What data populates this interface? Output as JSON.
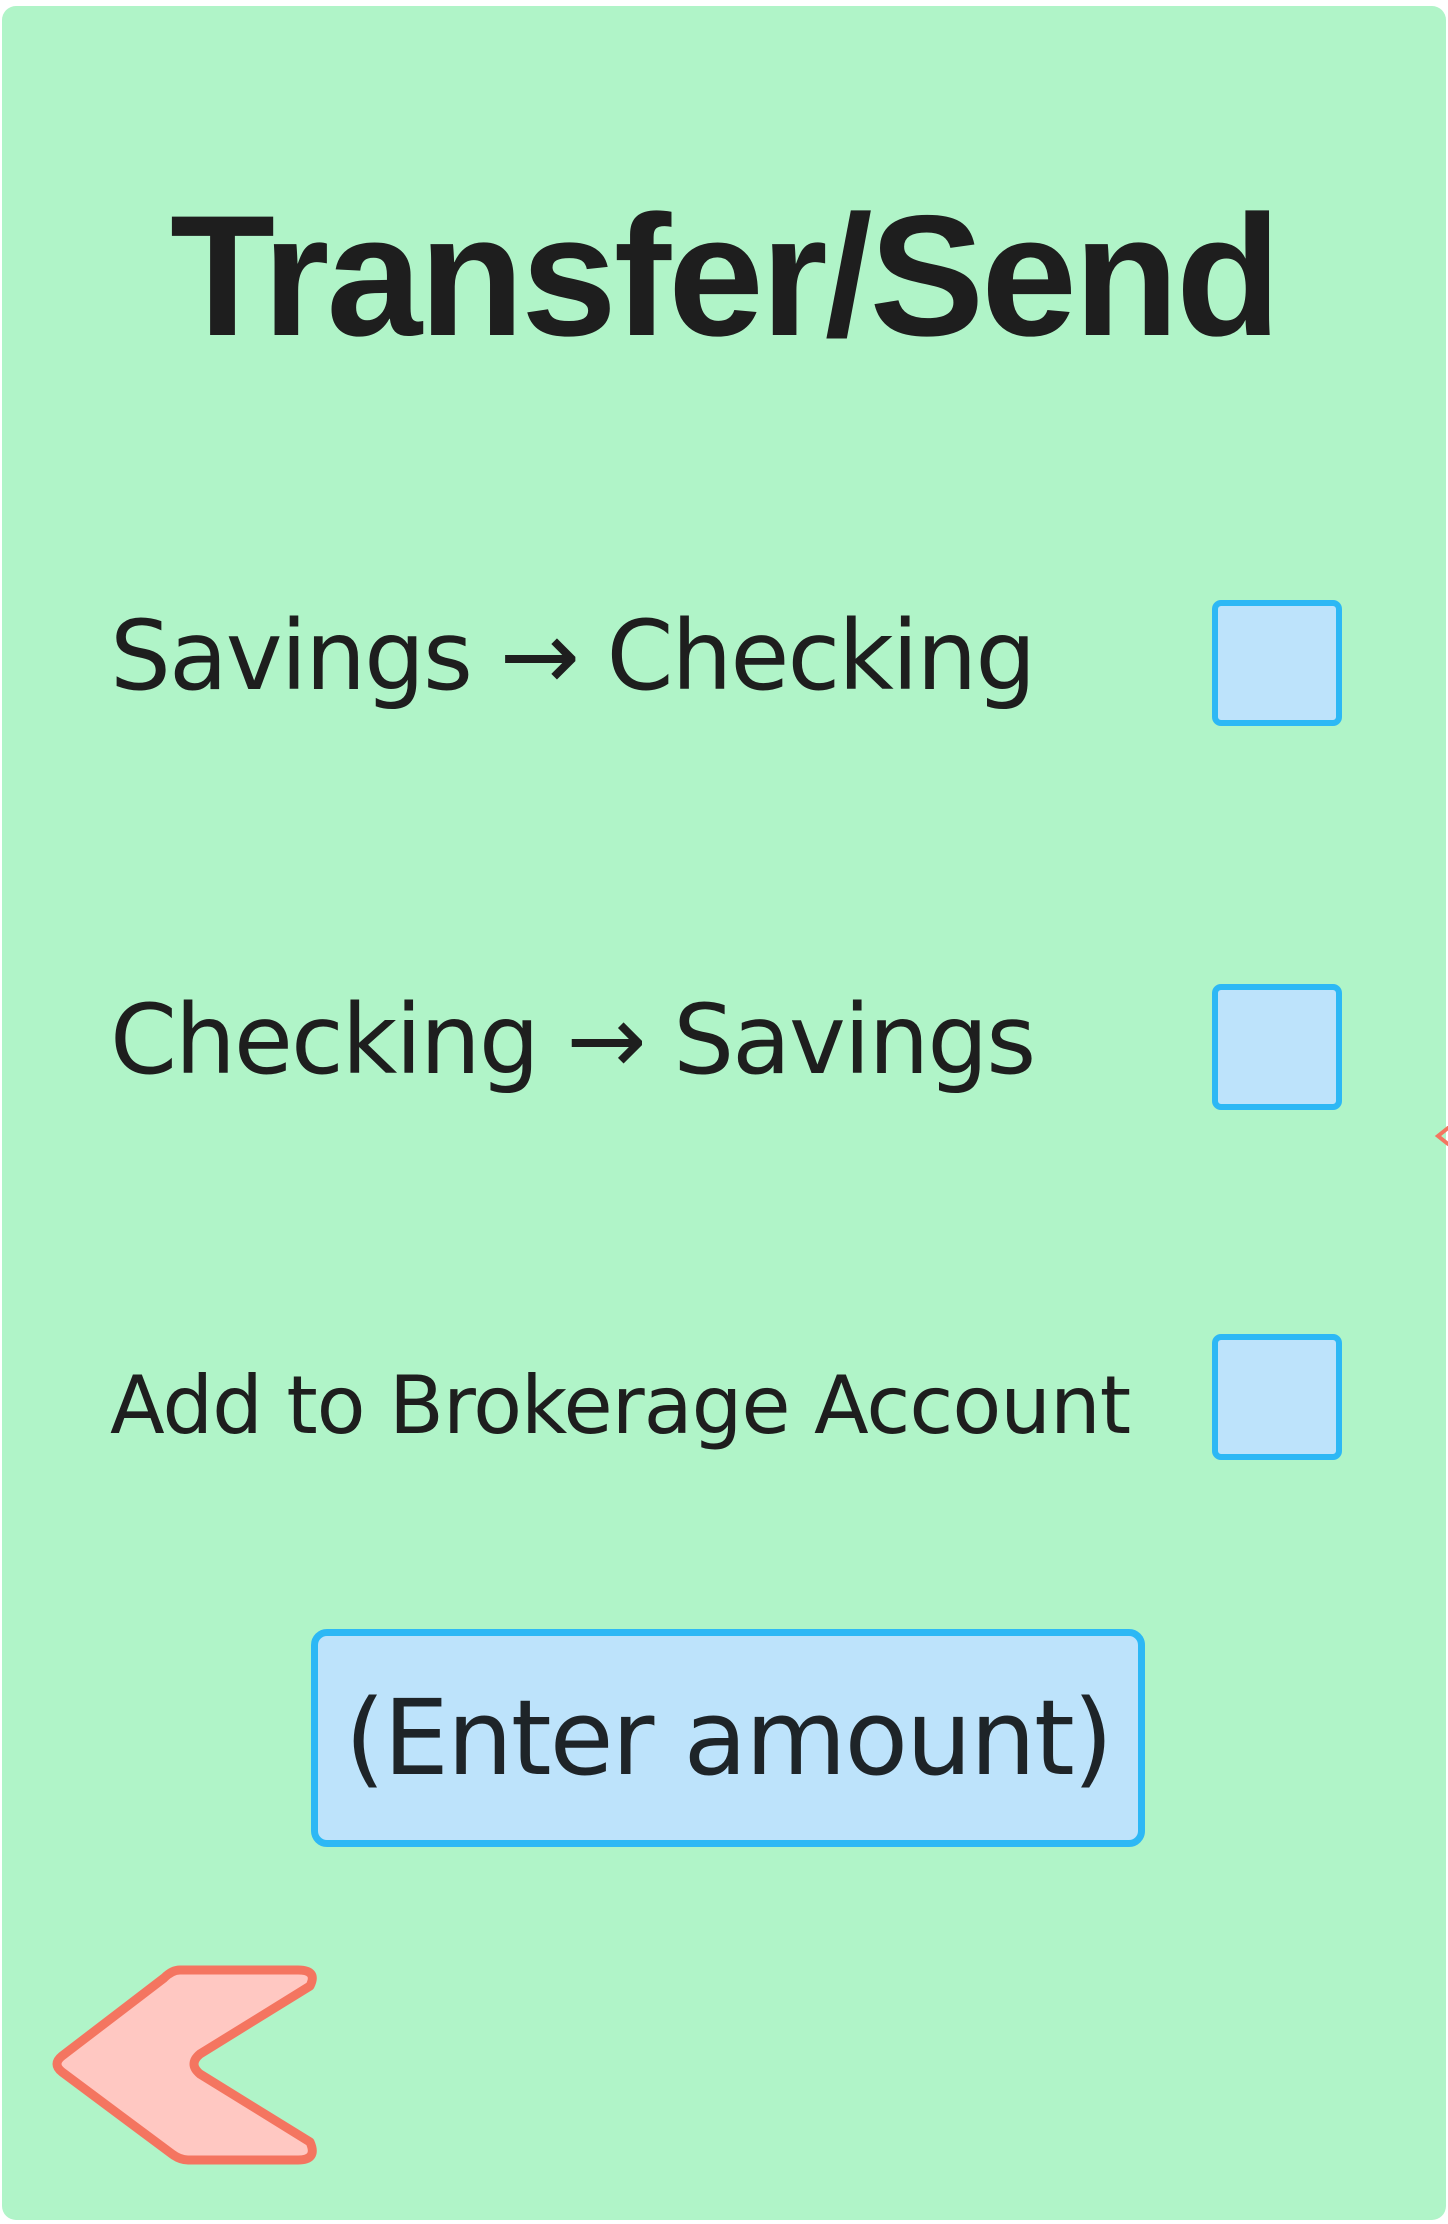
{
  "screen": {
    "title": "Transfer/Send"
  },
  "options": [
    {
      "label": "Savings → Checking",
      "checked": false
    },
    {
      "label": "Checking → Savings",
      "checked": false
    },
    {
      "label": "Add to Brokerage Account",
      "checked": false
    }
  ],
  "amount_button": {
    "label": "(Enter amount)"
  },
  "navigation": {
    "back_icon": "chevron-left-icon"
  },
  "colors": {
    "background": "#b0f4c8",
    "input_fill": "#bde3fb",
    "input_border": "#2db8f5",
    "back_fill": "#ffc8c2",
    "back_border": "#f47560",
    "text": "#1e1e1e"
  }
}
